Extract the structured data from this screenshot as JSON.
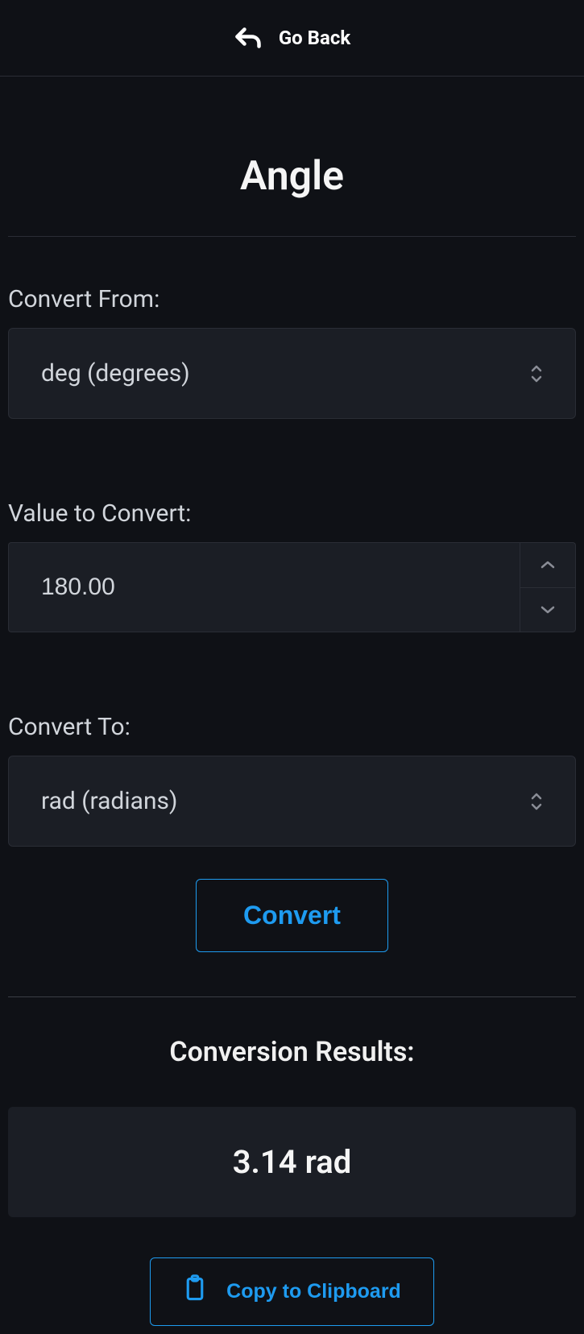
{
  "header": {
    "back_label": "Go Back"
  },
  "title": "Angle",
  "convert_from": {
    "label": "Convert From:",
    "value": "deg (degrees)"
  },
  "value_to_convert": {
    "label": "Value to Convert:",
    "value": "180.00"
  },
  "convert_to": {
    "label": "Convert To:",
    "value": "rad (radians)"
  },
  "convert_button": "Convert",
  "results": {
    "title": "Conversion Results:",
    "value": "3.14 rad"
  },
  "copy_button": "Copy to Clipboard",
  "colors": {
    "accent": "#1e9bf0",
    "bg": "#0f1116",
    "panel": "#1b1e25"
  }
}
